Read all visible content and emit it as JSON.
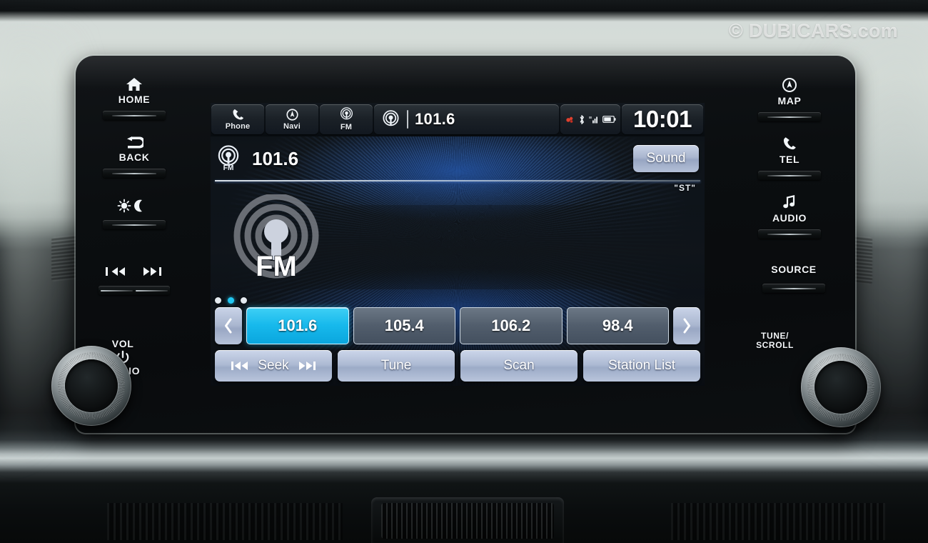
{
  "watermark": "© DUBICARS.com",
  "screen": {
    "status_bar": {
      "tabs": [
        {
          "label": "Phone",
          "icon": "phone-icon"
        },
        {
          "label": "Navi",
          "icon": "navigation-icon"
        },
        {
          "label": "FM",
          "icon": "radio-wave-icon"
        }
      ],
      "now_playing": {
        "icon": "radio-wave-icon",
        "frequency": "101.6"
      },
      "system_icons": [
        "usb-icon",
        "bluetooth-icon",
        "signal-bars-icon",
        "battery-icon"
      ],
      "clock": "10:01"
    },
    "now_playing_row": {
      "source_icon": "radio-wave-fm-icon",
      "frequency": "101.6",
      "sound_button": "Sound",
      "stereo_indicator": "\"ST\""
    },
    "artwork": {
      "icon": "fm-radio-wave-large-icon",
      "label": "FM"
    },
    "presets": {
      "page_dots": 3,
      "active_dot_index": 1,
      "prev_label": "‹",
      "next_label": "›",
      "items": [
        {
          "frequency": "101.6",
          "active": true
        },
        {
          "frequency": "105.4",
          "active": false
        },
        {
          "frequency": "106.2",
          "active": false
        },
        {
          "frequency": "98.4",
          "active": false
        }
      ]
    },
    "functions": [
      {
        "label": "Seek",
        "icon_left": "skip-back-icon",
        "icon_right": "skip-forward-icon"
      },
      {
        "label": "Tune",
        "icon_left": "",
        "icon_right": ""
      },
      {
        "label": "Scan",
        "icon_left": "",
        "icon_right": ""
      },
      {
        "label": "Station List",
        "icon_left": "",
        "icon_right": ""
      }
    ],
    "colors": {
      "accent_cyan": "#17b9ec",
      "button_face": "#adbad3",
      "preset_face": "#515d6c"
    }
  },
  "left_keys": [
    {
      "label": "HOME",
      "icon": "home-icon"
    },
    {
      "label": "BACK",
      "icon": "back-arrow-icon"
    },
    {
      "label": "",
      "icon": "brightness-day-night-icon"
    },
    {
      "label": "",
      "icon": "prev-next-track-icon"
    }
  ],
  "left_knob": {
    "line1": "VOL",
    "line2": "AUDIO",
    "icon": "power-icon"
  },
  "right_keys": [
    {
      "label": "MAP",
      "icon": "map-pin-icon"
    },
    {
      "label": "TEL",
      "icon": "phone-icon"
    },
    {
      "label": "AUDIO",
      "icon": "music-note-icon"
    },
    {
      "label": "SOURCE",
      "icon": ""
    }
  ],
  "right_knob": {
    "line1": "TUNE/",
    "line2": "SCROLL"
  }
}
